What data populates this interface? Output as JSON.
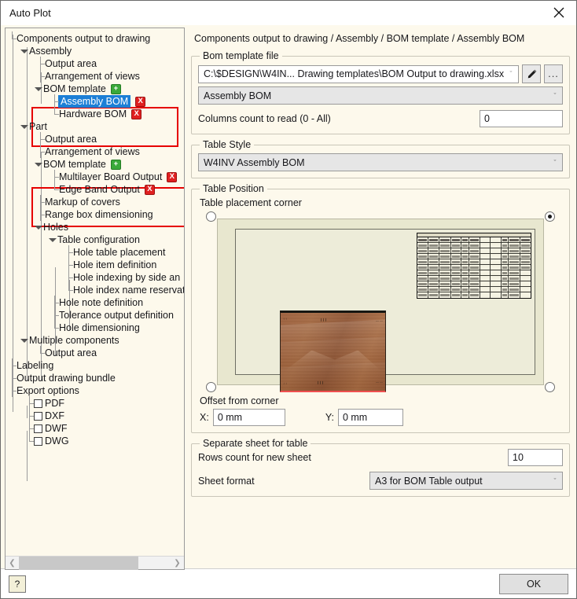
{
  "window": {
    "title": "Auto Plot",
    "close_icon": "close-icon"
  },
  "tree": {
    "items": [
      {
        "label": "Components output to drawing"
      },
      {
        "label": "Assembly"
      },
      {
        "label": "Output area"
      },
      {
        "label": "Arrangement of views"
      },
      {
        "label": "BOM template",
        "add_badge": "+"
      },
      {
        "label": "Assembly BOM",
        "del_badge": "X",
        "selected": true
      },
      {
        "label": "Hardware BOM",
        "del_badge": "X"
      },
      {
        "label": "Part"
      },
      {
        "label": "Output area"
      },
      {
        "label": "Arrangement of views"
      },
      {
        "label": "BOM template",
        "add_badge": "+"
      },
      {
        "label": "Multilayer Board Output",
        "del_badge": "X"
      },
      {
        "label": "Edge Band Output",
        "del_badge": "X"
      },
      {
        "label": "Markup of covers"
      },
      {
        "label": "Range box dimensioning"
      },
      {
        "label": "Holes"
      },
      {
        "label": "Table configuration"
      },
      {
        "label": "Hole table placement"
      },
      {
        "label": "Hole item definition"
      },
      {
        "label": "Hole indexing by side an"
      },
      {
        "label": "Hole index name reservat"
      },
      {
        "label": "Hole note definition"
      },
      {
        "label": "Tolerance output definition"
      },
      {
        "label": "Hole dimensioning"
      },
      {
        "label": "Multiple components"
      },
      {
        "label": "Output area"
      },
      {
        "label": "Labeling"
      },
      {
        "label": "Output drawing bundle"
      },
      {
        "label": "Export options"
      },
      {
        "label": "PDF",
        "checkbox": false
      },
      {
        "label": "DXF",
        "checkbox": false
      },
      {
        "label": "DWF",
        "checkbox": false
      },
      {
        "label": "DWG",
        "checkbox": false
      }
    ],
    "scroll_left_icon": "chevron-left-icon",
    "scroll_right_icon": "chevron-right-icon"
  },
  "content": {
    "breadcrumb": "Components output to drawing / Assembly / BOM template / Assembly BOM",
    "bom_template_file": {
      "legend": "Bom template file",
      "file_path": "C:\\$DESIGN\\W4IN... Drawing templates\\BOM Output to drawing.xlsx",
      "file_caret": "ˇ",
      "edit_icon": "pencil-icon",
      "browse_label": "...",
      "sheet_value": "Assembly BOM",
      "sheet_caret": "ˇ",
      "columns_label": "Columns count to read (0 - All)",
      "columns_value": "0"
    },
    "table_style": {
      "legend": "Table Style",
      "value": "W4INV Assembly BOM",
      "caret": "ˇ"
    },
    "table_position": {
      "legend": "Table Position",
      "corner_label": "Table placement corner",
      "corners": [
        {
          "name": "top-left",
          "selected": false
        },
        {
          "name": "top-right",
          "selected": true
        },
        {
          "name": "bottom-left",
          "selected": false
        },
        {
          "name": "bottom-right",
          "selected": false
        }
      ],
      "offset_label": "Offset from corner",
      "x_label": "X:",
      "x_value": "0 mm",
      "y_label": "Y:",
      "y_value": "0 mm"
    },
    "separate_sheet": {
      "legend": "Separate sheet for table",
      "rows_label": "Rows count for new sheet",
      "rows_value": "10",
      "format_label": "Sheet format",
      "format_value": "A3 for BOM Table output",
      "caret": "ˇ"
    }
  },
  "footer": {
    "help_icon": "help-icon",
    "help_label": "?",
    "ok_label": "OK"
  },
  "colors": {
    "background": "#fdf9ec",
    "selection": "#1c7fd6",
    "highlight_box": "#e60000",
    "add_badge": "#3aa93a",
    "delete_badge": "#e02020"
  }
}
